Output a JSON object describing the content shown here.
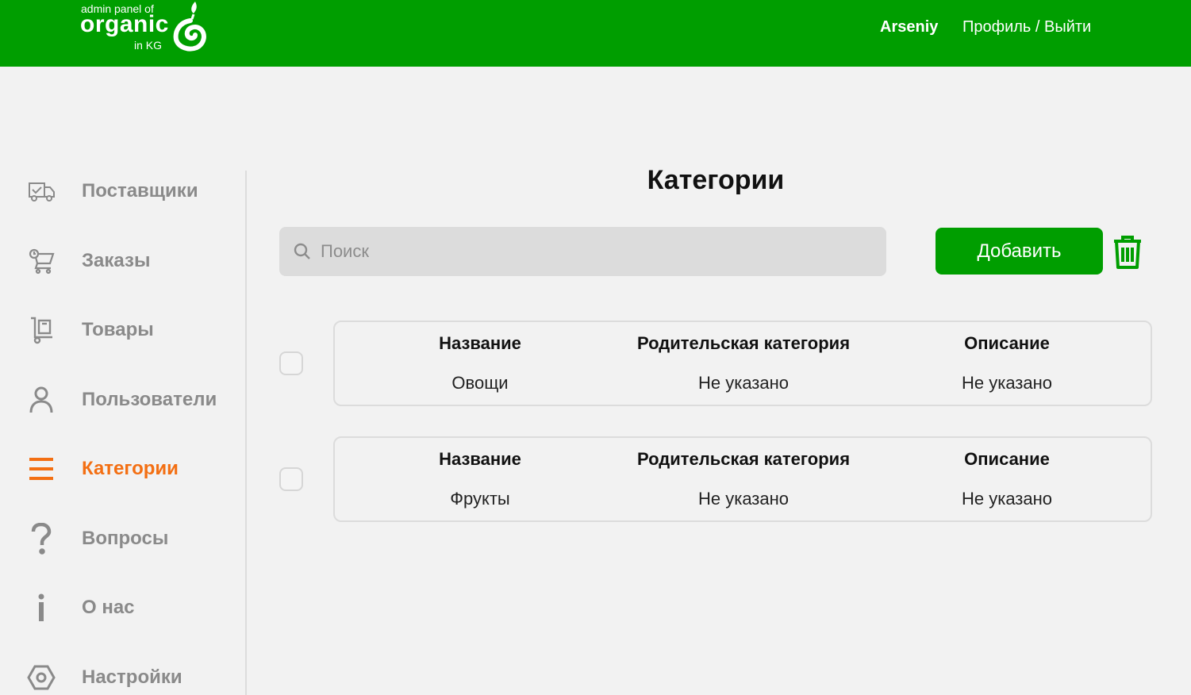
{
  "header": {
    "logo_line1": "admin panel of",
    "logo_line2": "organic",
    "logo_line3": "in KG",
    "user_name": "Arseniy",
    "profile_link": "Профиль / Выйти",
    "bg_color": "#009e00"
  },
  "sidebar": {
    "items": [
      {
        "label": "Поставщики",
        "icon": "delivery-truck-icon",
        "active": false
      },
      {
        "label": "Заказы",
        "icon": "shopping-cart-icon",
        "active": false
      },
      {
        "label": "Товары",
        "icon": "hand-truck-icon",
        "active": false
      },
      {
        "label": "Пользователи",
        "icon": "user-icon",
        "active": false
      },
      {
        "label": "Категории",
        "icon": "hamburger-menu-icon",
        "active": true
      },
      {
        "label": "Вопросы",
        "icon": "question-mark-icon",
        "active": false
      },
      {
        "label": "О нас",
        "icon": "info-icon",
        "active": false
      },
      {
        "label": "Настройки",
        "icon": "settings-hexagon-icon",
        "active": false
      }
    ],
    "active_color": "#f36f13"
  },
  "main": {
    "title": "Категории",
    "search": {
      "placeholder": "Поиск",
      "value": ""
    },
    "add_label": "Добавить",
    "columns": {
      "name": "Название",
      "parent": "Родительская категория",
      "description": "Описание"
    },
    "rows": [
      {
        "name": "Овощи",
        "parent": "Не указано",
        "description": "Не указано"
      },
      {
        "name": "Фрукты",
        "parent": "Не указано",
        "description": "Не указано"
      }
    ]
  }
}
